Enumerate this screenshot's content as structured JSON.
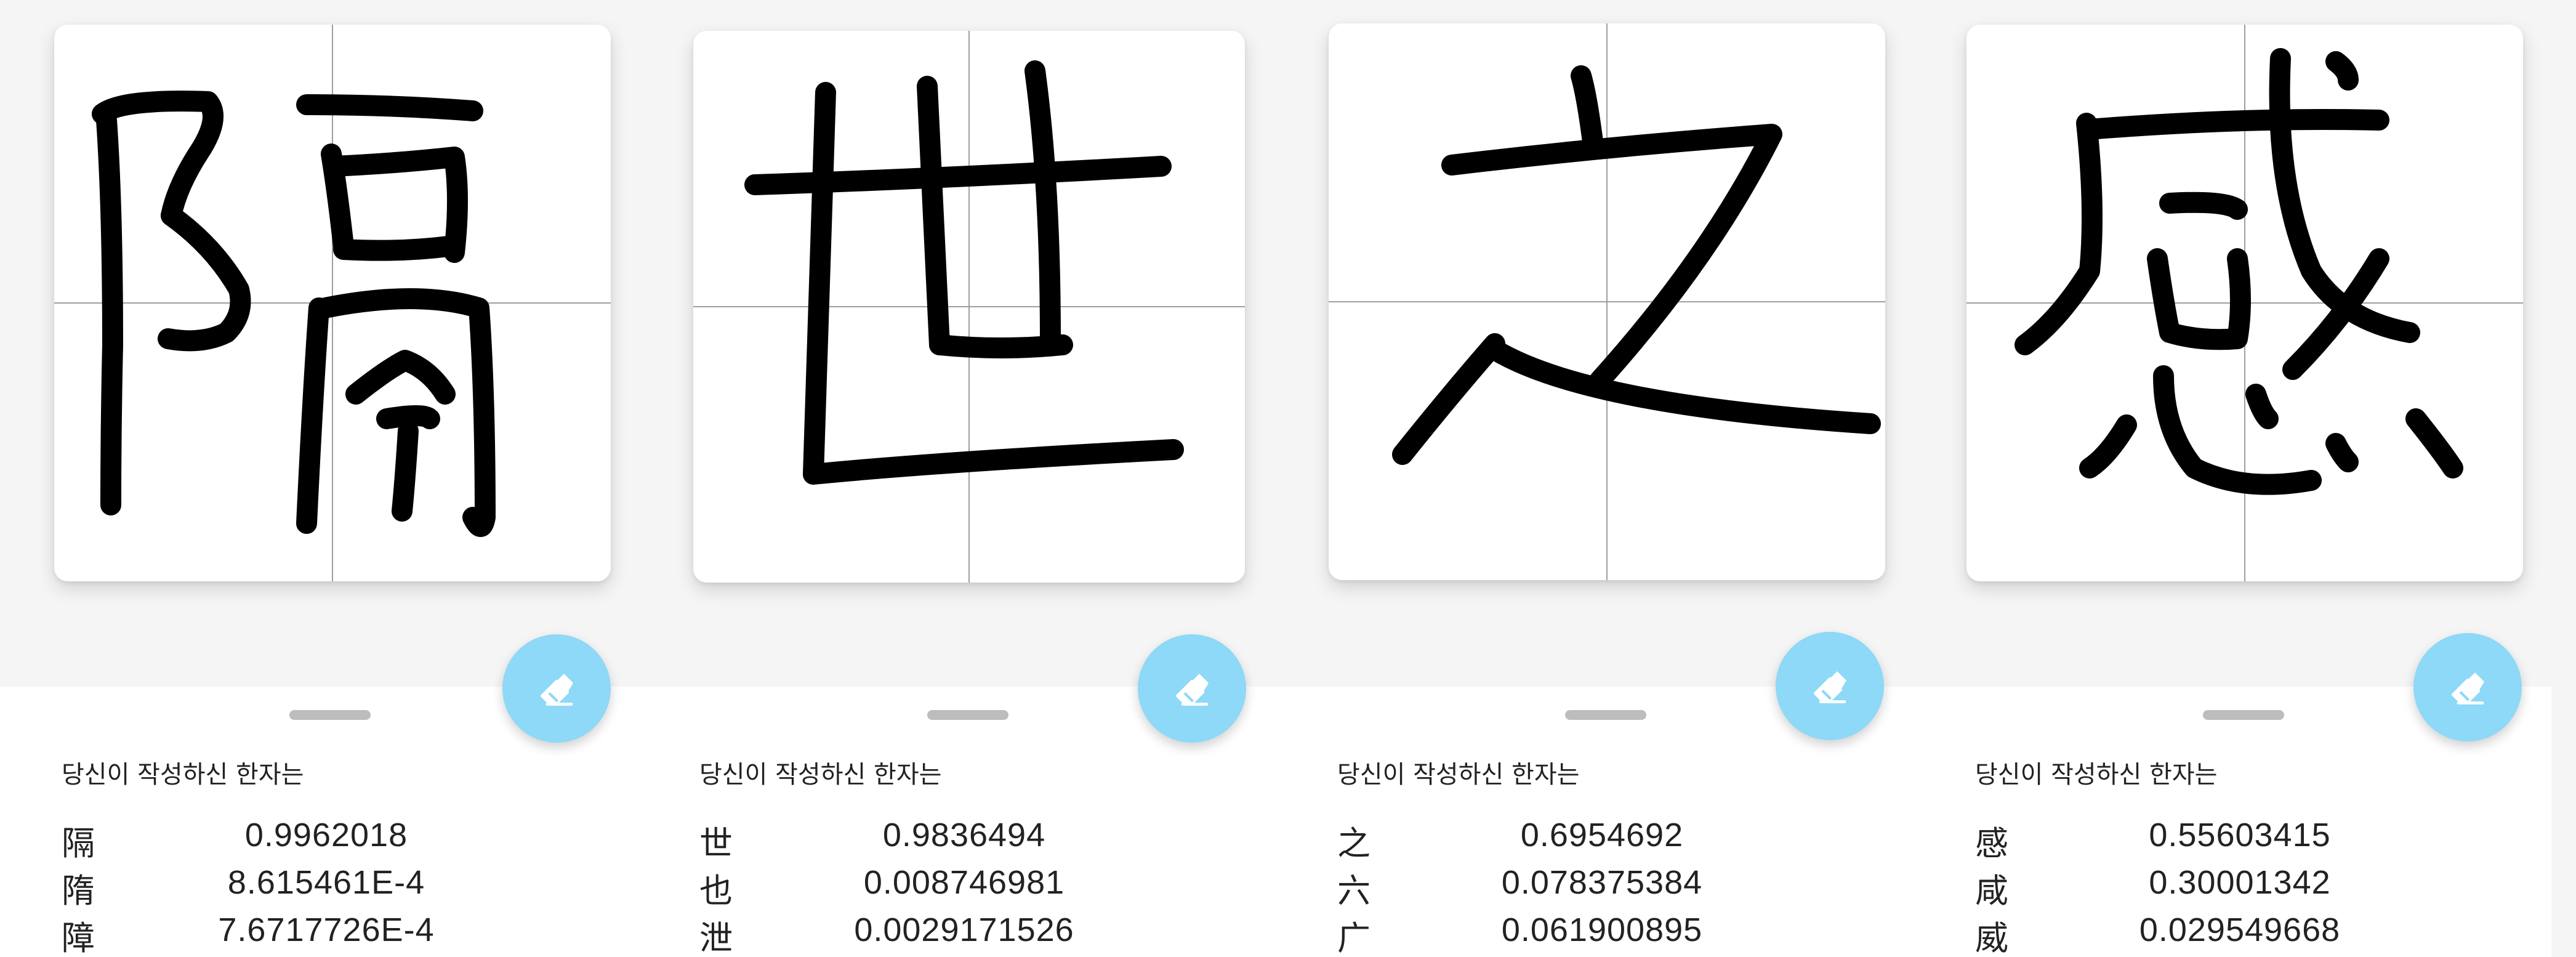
{
  "panels": [
    {
      "character_drawn": "隔",
      "sheet_title": "당신이 작성하신 한자는",
      "results": [
        {
          "char": "隔",
          "score": "0.9962018"
        },
        {
          "char": "隋",
          "score": "8.615461E-4"
        },
        {
          "char": "障",
          "score": "7.6717726E-4"
        }
      ],
      "erase_icon": "eraser-icon"
    },
    {
      "character_drawn": "世",
      "sheet_title": "당신이 작성하신 한자는",
      "results": [
        {
          "char": "世",
          "score": "0.9836494"
        },
        {
          "char": "也",
          "score": "0.008746981"
        },
        {
          "char": "泄",
          "score": "0.0029171526"
        }
      ],
      "erase_icon": "eraser-icon"
    },
    {
      "character_drawn": "之",
      "sheet_title": "당신이 작성하신 한자는",
      "results": [
        {
          "char": "之",
          "score": "0.6954692"
        },
        {
          "char": "六",
          "score": "0.078375384"
        },
        {
          "char": "广",
          "score": "0.061900895"
        }
      ],
      "erase_icon": "eraser-icon"
    },
    {
      "character_drawn": "感",
      "sheet_title": "당신이 작성하신 한자는",
      "results": [
        {
          "char": "感",
          "score": "0.55603415"
        },
        {
          "char": "咸",
          "score": "0.30001342"
        },
        {
          "char": "威",
          "score": "0.029549668"
        }
      ],
      "erase_icon": "eraser-icon"
    }
  ],
  "colors": {
    "fab": "#8ed8f8",
    "ink": "#000000",
    "guide": "#9e9e9e",
    "handle": "#bdbdbd"
  }
}
